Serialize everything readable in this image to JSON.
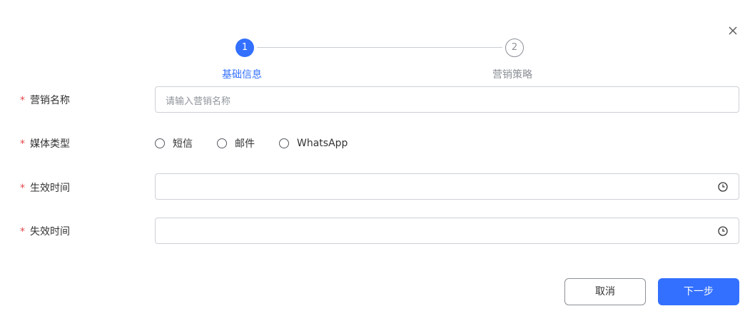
{
  "steps": [
    {
      "number": "1",
      "label": "基础信息",
      "state": "active"
    },
    {
      "number": "2",
      "label": "营销策略",
      "state": "pending"
    }
  ],
  "form": {
    "name": {
      "required_mark": "*",
      "label": "营销名称",
      "placeholder": "请输入营销名称",
      "value": ""
    },
    "media": {
      "required_mark": "*",
      "label": "媒体类型",
      "options": [
        {
          "label": "短信",
          "checked": false
        },
        {
          "label": "邮件",
          "checked": false
        },
        {
          "label": "WhatsApp",
          "checked": false
        }
      ]
    },
    "effective_time": {
      "required_mark": "*",
      "label": "生效时间",
      "value": ""
    },
    "expire_time": {
      "required_mark": "*",
      "label": "失效时间",
      "value": ""
    }
  },
  "buttons": {
    "cancel": "取消",
    "next": "下一步"
  },
  "icons": {
    "close": "close-icon",
    "time": "clock-icon"
  },
  "colors": {
    "primary": "#3370ff",
    "required": "#e5484d",
    "muted": "#8b8f96"
  }
}
